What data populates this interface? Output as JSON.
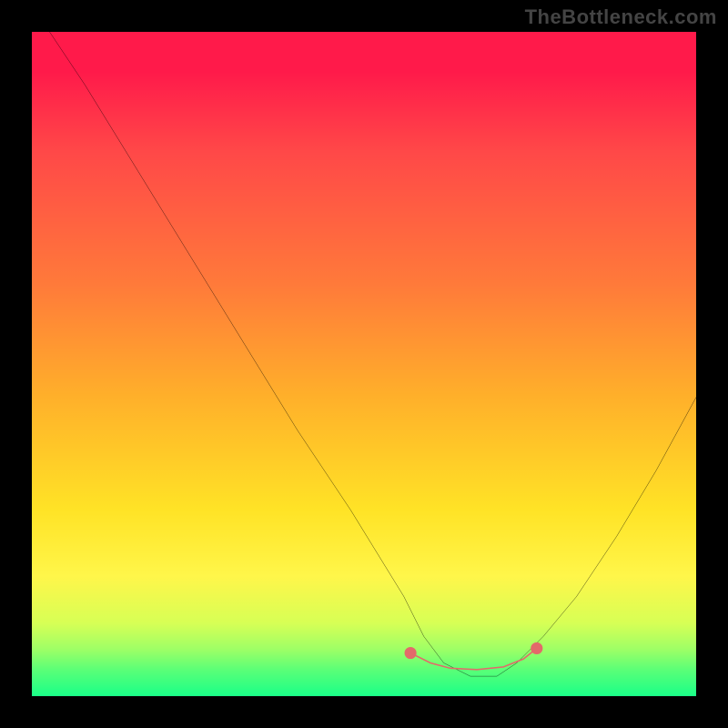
{
  "watermark": "TheBottleneck.com",
  "chart_data": {
    "type": "line",
    "title": "",
    "xlabel": "",
    "ylabel": "",
    "xlim": [
      0,
      100
    ],
    "ylim": [
      0,
      100
    ],
    "series": [
      {
        "name": "bottleneck-curve",
        "x": [
          0,
          8,
          16,
          24,
          32,
          40,
          48,
          56,
          59,
          62,
          66,
          70,
          73,
          77,
          82,
          88,
          94,
          100
        ],
        "y": [
          104,
          92,
          79,
          66,
          53,
          40,
          28,
          15,
          9,
          5,
          3,
          3,
          5,
          9,
          15,
          24,
          34,
          45
        ]
      },
      {
        "name": "optimal-band",
        "x": [
          57,
          60,
          63,
          67,
          71,
          74,
          76
        ],
        "y": [
          6.5,
          5.0,
          4.2,
          4.0,
          4.4,
          5.6,
          7.2
        ]
      }
    ],
    "gradient_stops": [
      {
        "pos": 0,
        "color": "#ff1a4a"
      },
      {
        "pos": 6,
        "color": "#ff1a4a"
      },
      {
        "pos": 18,
        "color": "#ff4848"
      },
      {
        "pos": 38,
        "color": "#ff7a3a"
      },
      {
        "pos": 55,
        "color": "#ffb02a"
      },
      {
        "pos": 72,
        "color": "#ffe326"
      },
      {
        "pos": 82,
        "color": "#fff64a"
      },
      {
        "pos": 89,
        "color": "#d7ff55"
      },
      {
        "pos": 93,
        "color": "#9dff66"
      },
      {
        "pos": 96,
        "color": "#5bff77"
      },
      {
        "pos": 100,
        "color": "#1aff88"
      }
    ],
    "curve_color": "#000000",
    "optimal_band_color": "#e36a6a"
  }
}
